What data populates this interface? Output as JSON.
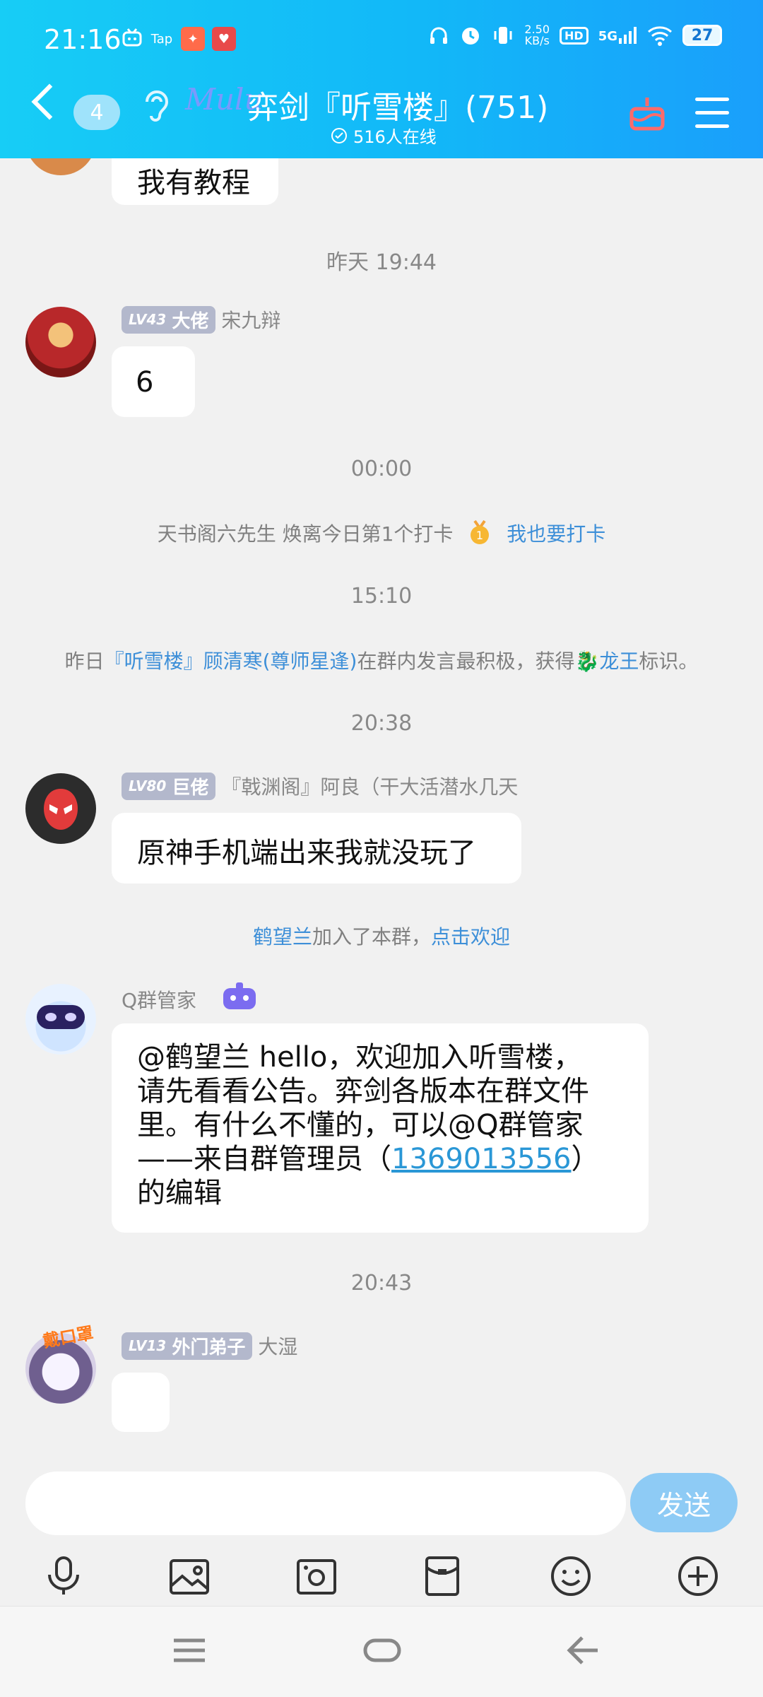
{
  "status_bar": {
    "time": "21:16",
    "net_speed_value": "2.50",
    "net_speed_unit": "KB/s",
    "hd": "HD",
    "net_type": "5G",
    "battery": "27"
  },
  "header": {
    "unread_count": "4",
    "logo_text": "Mulu",
    "title": "弈剑『听雪楼』(751)",
    "online": "516人在线"
  },
  "messages": {
    "m0_text": "我有教程",
    "ts1": "昨天  19:44",
    "m1": {
      "level": "LV43",
      "title": "大佬",
      "name": "宋九辩",
      "text": "6"
    },
    "ts2": "00:00",
    "checkin": {
      "text": "天书阁六先生  焕离今日第1个打卡",
      "link": "我也要打卡"
    },
    "ts3": "15:10",
    "dragon": {
      "prefix": "昨日",
      "user": "『听雪楼』顾清寒(尊师星逢)",
      "middle": "在群内发言最积极，获得",
      "badge": "龙王",
      "suffix": "标识。"
    },
    "ts4": "20:38",
    "m2": {
      "level": "LV80",
      "title": "巨佬",
      "name": "『戟渊阁』阿良（干大活潜水几天",
      "text": "原神手机端出来我就没玩了"
    },
    "join": {
      "user": "鹤望兰",
      "middle": "加入了本群，",
      "link": "点击欢迎"
    },
    "m3": {
      "name": "Q群管家",
      "line1": "@鹤望兰  hello，欢迎加入听雪楼，",
      "line2": "请先看看公告。弈剑各版本在群文件",
      "line3": "里。有什么不懂的，可以@Q群管家",
      "line4_pre": "——来自群管理员（",
      "line4_link": "1369013556",
      "line4_post": "）",
      "line5": "的编辑"
    },
    "ts5": "20:43",
    "m4": {
      "level": "LV13",
      "title": "外门弟子",
      "name": "大湿",
      "avatar_tag": "戴口罩"
    }
  },
  "input_bar": {
    "placeholder": "",
    "send_label": "发送"
  },
  "colors": {
    "header_start": "#17cdf6",
    "header_end": "#1a9ffb",
    "link": "#3d8fd8",
    "send": "#8ecbf5"
  }
}
